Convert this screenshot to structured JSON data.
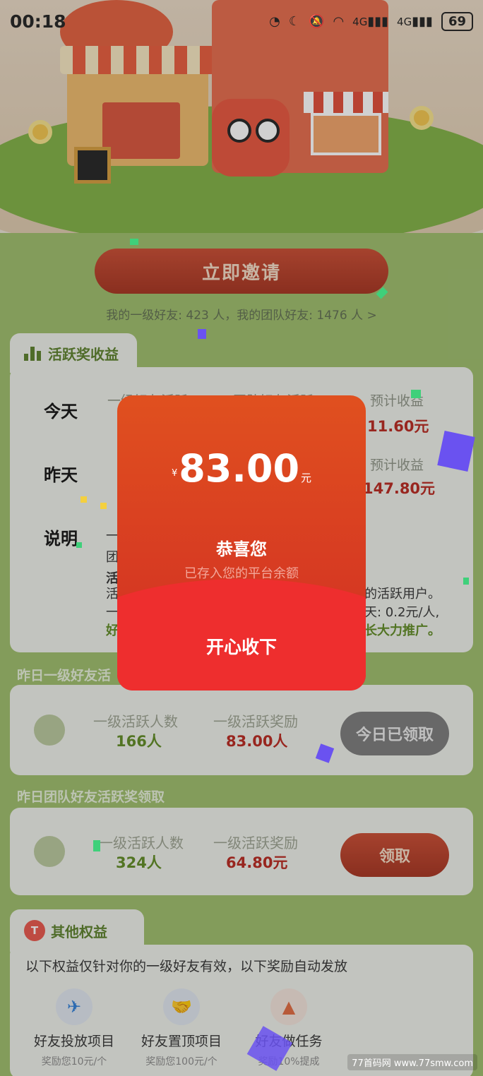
{
  "status": {
    "time": "00:18",
    "signal_a": "4G",
    "signal_b": "4G",
    "battery": "69"
  },
  "invite": {
    "button_label": "立即邀请",
    "friends_line": "我的一级好友: 423 人，我的团队好友: 1476 人 >"
  },
  "active": {
    "tab_title": "活跃奖收益",
    "rows": {
      "today": "今天",
      "yesterday": "昨天",
      "note": "说明"
    },
    "col_first": "一级好友活跃",
    "col_team": "团队好友活跃",
    "col_est": "预计收益",
    "today_est": "11.60元",
    "yesterday_est": "147.80元",
    "desc_line1": "一",
    "desc_line2": "团",
    "desc_line3_bold": "活",
    "desc_line4": "活",
    "desc_line4_right": "的活跃用户。",
    "desc_line5": "一",
    "desc_line5_right": "天: 0.2元/人,",
    "desc_line6": "好",
    "desc_line6_right": "长大力推广。"
  },
  "yesterday_first": {
    "section_title": "昨日一级好友活",
    "count_label": "一级活跃人数",
    "count_value": "166人",
    "reward_label": "一级活跃奖励",
    "reward_value": "83.00人",
    "button_label": "今日已领取"
  },
  "yesterday_team": {
    "section_title": "昨日团队好友活跃奖领取",
    "count_label": "一级活跃人数",
    "count_value": "324人",
    "reward_label": "一级活跃奖励",
    "reward_value": "64.80元",
    "button_label": "领取"
  },
  "other": {
    "tab_title": "其他权益",
    "tab_icon_letter": "T",
    "desc": "以下权益仅针对你的一级好友有效，以下奖励自动发放",
    "items": [
      {
        "name": "好友投放项目",
        "sub": "奖励您10元/个",
        "icon": "paper-plane-icon"
      },
      {
        "name": "好友置顶项目",
        "sub": "奖励您100元/个",
        "icon": "handshake-icon"
      },
      {
        "name": "好友做任务",
        "sub": "奖励10%提成",
        "icon": "stamp-icon"
      }
    ]
  },
  "modal": {
    "currency": "¥",
    "amount": "83.00",
    "unit": "元",
    "congrats": "恭喜您",
    "subtitle": "已存入您的平台余额",
    "accept_label": "开心收下"
  },
  "watermark": "77首码网 www.77smw.com",
  "colors": {
    "accent_red": "#d12d24",
    "brand_green": "#5a7f2a",
    "bg_green": "#9dbd6a"
  }
}
